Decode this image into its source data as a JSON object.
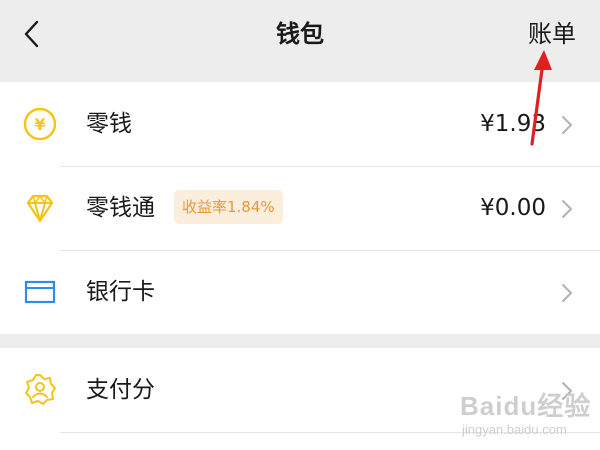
{
  "header": {
    "title": "钱包",
    "bill_label": "账单",
    "back_icon": "chevron-left-icon"
  },
  "rows": [
    {
      "label": "零钱",
      "amount": "¥1.93",
      "icon": "yuan-coin-icon",
      "icon_color": "#f5c416"
    },
    {
      "label": "零钱通",
      "badge": "收益率1.84%",
      "amount": "¥0.00",
      "icon": "diamond-icon",
      "icon_color": "#f5c416"
    },
    {
      "label": "银行卡",
      "amount": "",
      "icon": "bank-card-icon",
      "icon_color": "#2c8cf0"
    },
    {
      "label": "支付分",
      "amount": "",
      "icon": "score-badge-icon",
      "icon_color": "#f5c416"
    }
  ],
  "annotation": {
    "color": "#e02020"
  },
  "watermark": {
    "main": "Baidu经验",
    "sub": "jingyan.baidu.com"
  },
  "colors": {
    "background": "#ededed",
    "card": "#ffffff",
    "badge_bg": "#fbeedd",
    "badge_text": "#e8963e"
  }
}
